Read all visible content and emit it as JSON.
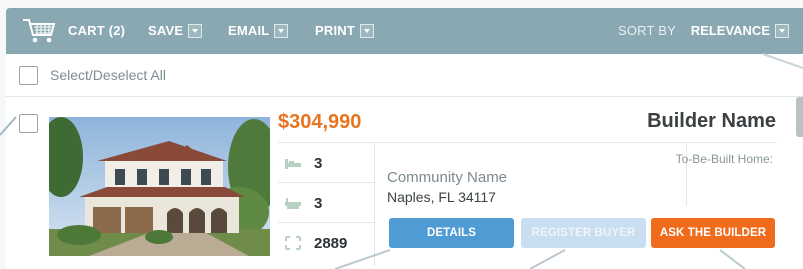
{
  "toolbar": {
    "cart_label": "CART (2)",
    "save_label": "SAVE",
    "email_label": "EMAIL",
    "print_label": "PRINT",
    "sort_label": "SORT BY",
    "sort_value": "RELEVANCE"
  },
  "select_all": {
    "label": "Select/Deselect All",
    "checked": false
  },
  "listing": {
    "price": "$304,990",
    "builder_name": "Builder Name",
    "beds": "3",
    "baths": "3",
    "sqft": "2889",
    "community_name": "Community Name",
    "location": "Naples, FL 34117",
    "status": "To-Be-Built Home:",
    "buttons": {
      "details": "DETAILS",
      "register": "REGISTER BUYER",
      "ask": "ASK THE BUILDER"
    }
  },
  "icons": {
    "cart": "cart-icon",
    "bed": "bed-icon",
    "bath": "bath-icon",
    "sqft": "expand-arrows-icon"
  },
  "colors": {
    "toolbar_bg": "#8aa8b1",
    "price": "#e7751f",
    "details_button": "#4f9bd3",
    "register_button": "#c9def0",
    "ask_button": "#f06b1c"
  }
}
